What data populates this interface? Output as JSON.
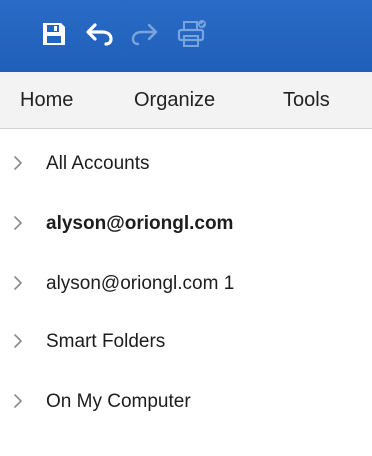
{
  "toolbar": {
    "buttons": [
      {
        "name": "save",
        "icon": "save-icon",
        "enabled": true
      },
      {
        "name": "undo",
        "icon": "undo-icon",
        "enabled": true
      },
      {
        "name": "redo",
        "icon": "redo-icon",
        "enabled": false
      },
      {
        "name": "print",
        "icon": "print-icon",
        "enabled": false
      }
    ],
    "colors": {
      "titlebar": "#2166c3",
      "icon": "#ffffff",
      "icon_disabled": "#7aa4dd"
    }
  },
  "menubar": {
    "items": [
      {
        "label": "Home"
      },
      {
        "label": "Organize"
      },
      {
        "label": "Tools"
      }
    ]
  },
  "folders": {
    "items": [
      {
        "label": "All Accounts",
        "bold": false,
        "icon": "chevron-right-icon"
      },
      {
        "label": "alyson@oriongl.com",
        "bold": true,
        "icon": "chevron-right-icon"
      },
      {
        "label": "alyson@oriongl.com 1",
        "bold": false,
        "icon": "chevron-right-icon"
      },
      {
        "label": "Smart Folders",
        "bold": false,
        "icon": "chevron-right-icon"
      },
      {
        "label": "On My Computer",
        "bold": false,
        "icon": "chevron-right-icon"
      }
    ]
  }
}
